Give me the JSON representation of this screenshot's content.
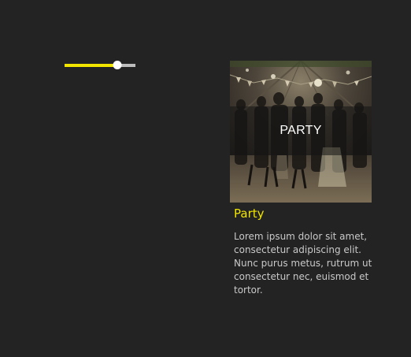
{
  "colors": {
    "background": "#232323",
    "accent": "#f2e600",
    "track": "#bdbdbd",
    "thumb": "#ffffff",
    "body_text": "#c9c9c9"
  },
  "slider": {
    "value_percent": 74
  },
  "card": {
    "image_icon": "party-photo",
    "banner_label": "PARTY",
    "title": "Party",
    "description": "Lorem ipsum dolor sit amet, consectetur adipiscing elit. Nunc purus metus, rutrum ut consectetur nec, euismod et tortor."
  }
}
